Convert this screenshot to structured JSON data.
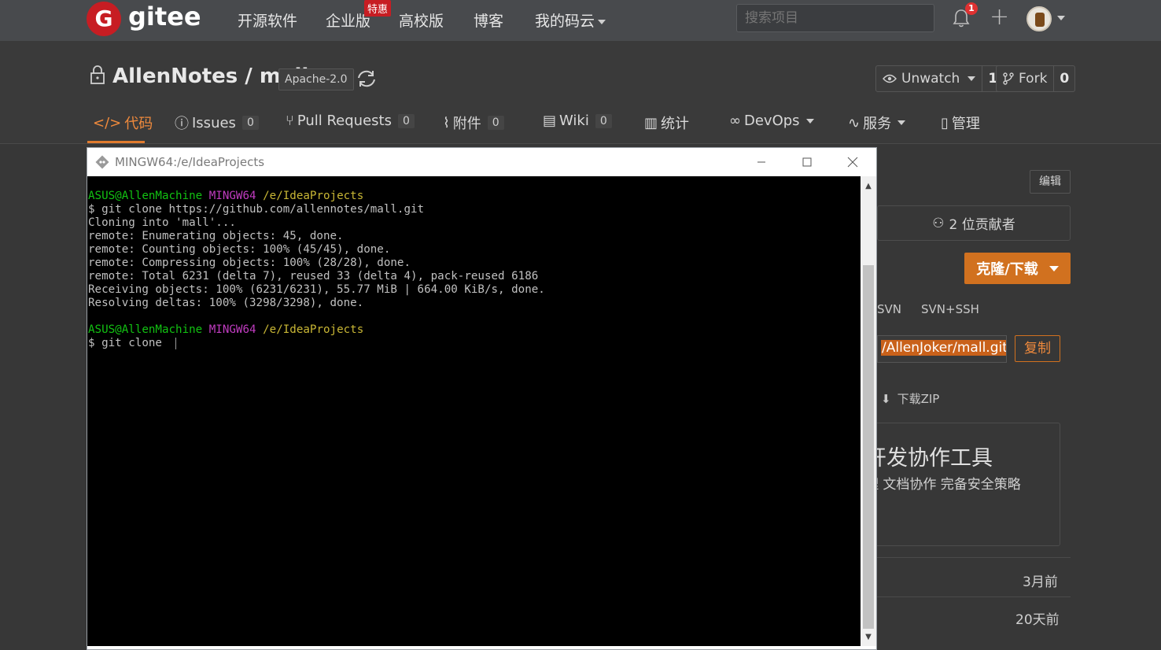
{
  "navbar": {
    "logo_letter": "G",
    "logo_text": "gitee",
    "items": [
      "开源软件",
      "企业版",
      "高校版",
      "博客",
      "我的码云"
    ],
    "hot_badge": "特惠",
    "search_placeholder": "搜索项目",
    "notification_count": "1"
  },
  "repo": {
    "owner_and_name": "AllenNotes / mall",
    "license": "Apache-2.0",
    "watch_label": "Unwatch",
    "watch_count": "1",
    "fork_label": "Fork",
    "fork_count": "0"
  },
  "tabs": [
    {
      "label": "代码",
      "count": ""
    },
    {
      "label": "Issues",
      "count": "0"
    },
    {
      "label": "Pull Requests",
      "count": "0"
    },
    {
      "label": "附件",
      "count": "0"
    },
    {
      "label": "Wiki",
      "count": "0"
    },
    {
      "label": "统计",
      "count": ""
    },
    {
      "label": "DevOps",
      "count": ""
    },
    {
      "label": "服务",
      "count": ""
    },
    {
      "label": "管理",
      "count": ""
    }
  ],
  "sidebar": {
    "edit_label": "编辑",
    "contributors": "2 位贡献者",
    "clone_label": "克隆/下载",
    "protocols": [
      "SVN",
      "SVN+SSH"
    ],
    "clone_url": "/AllenJoker/mall.git",
    "copy_label": "复制",
    "download_zip": "下载ZIP",
    "promo_title": "开发协作工具",
    "promo_subtitle": "理 文档协作 完备安全策略",
    "dates": [
      "3月前",
      "20天前"
    ]
  },
  "terminal": {
    "title": "MINGW64:/e/IdeaProjects",
    "prompt_user": "ASUS@AllenMachine",
    "prompt_env": "MINGW64",
    "prompt_path": "/e/IdeaProjects",
    "commands": [
      "$ git clone https://github.com/allennotes/mall.git",
      "$ git clone "
    ],
    "output": [
      "Cloning into 'mall'...",
      "remote: Enumerating objects: 45, done.",
      "remote: Counting objects: 100% (45/45), done.",
      "remote: Compressing objects: 100% (28/28), done.",
      "remote: Total 6231 (delta 7), reused 33 (delta 4), pack-reused 6186",
      "Receiving objects: 100% (6231/6231), 55.77 MiB | 664.00 KiB/s, done.",
      "Resolving deltas: 100% (3298/3298), done."
    ]
  },
  "colors": {
    "accent": "#d1711f",
    "brand_red": "#c71d23",
    "terminal_green": "#12c212",
    "terminal_magenta": "#c03cc0",
    "terminal_yellow": "#c9b735"
  }
}
